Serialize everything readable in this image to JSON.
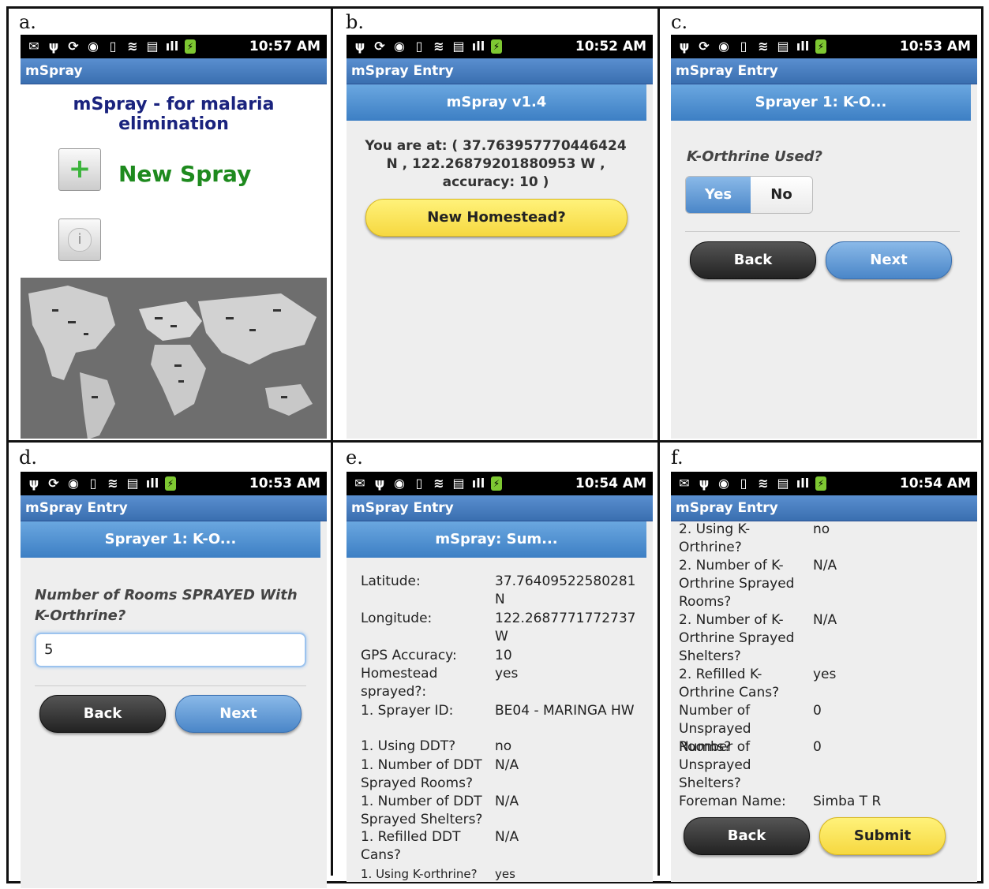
{
  "panels": {
    "a": {
      "label": "a.",
      "time": "10:57 AM",
      "appbar": "mSpray",
      "title": "mSpray - for malaria elimination",
      "new_spray": "New Spray",
      "plus": "+",
      "info": "i"
    },
    "b": {
      "label": "b.",
      "time": "10:52 AM",
      "appbar": "mSpray Entry",
      "header": "mSpray v1.4",
      "location": "You are at: ( 37.763957770446424 N , 122.26879201880953 W , accuracy: 10 )",
      "button": "New Homestead?"
    },
    "c": {
      "label": "c.",
      "time": "10:53 AM",
      "appbar": "mSpray Entry",
      "header": "Sprayer 1: K-O...",
      "question": "K-Orthrine Used?",
      "yes": "Yes",
      "no": "No",
      "back": "Back",
      "next": "Next"
    },
    "d": {
      "label": "d.",
      "time": "10:53 AM",
      "appbar": "mSpray Entry",
      "header": "Sprayer 1: K-O...",
      "question": "Number of Rooms SPRAYED With K-Orthrine?",
      "input_value": "5",
      "back": "Back",
      "next": "Next"
    },
    "e": {
      "label": "e.",
      "time": "10:54 AM",
      "appbar": "mSpray Entry",
      "header": "mSpray: Sum...",
      "rows": [
        {
          "k": "Latitude:",
          "v": "37.76409522580281 N"
        },
        {
          "k": "Longitude:",
          "v": "122.2687771772737 W"
        },
        {
          "k": "GPS Accuracy:",
          "v": "10"
        },
        {
          "k": "Homestead sprayed?:",
          "v": "yes"
        },
        {
          "k": "1. Sprayer ID:",
          "v": "BE04 - MARINGA HW"
        },
        {
          "k": "1. Using DDT?",
          "v": "no"
        },
        {
          "k": "1. Number of DDT Sprayed Rooms?",
          "v": "N/A"
        },
        {
          "k": "1. Number of DDT Sprayed Shelters?",
          "v": "N/A"
        },
        {
          "k": "1. Refilled DDT Cans?",
          "v": "N/A"
        },
        {
          "k": "1. Using K-orthrine?",
          "v": "yes"
        }
      ]
    },
    "f": {
      "label": "f.",
      "time": "10:54 AM",
      "appbar": "mSpray Entry",
      "rows": [
        {
          "k": "2. Using K-Orthrine?",
          "v": "no"
        },
        {
          "k": "2. Number of K-Orthrine Sprayed Rooms?",
          "v": "N/A"
        },
        {
          "k": "2. Number of K-Orthrine Sprayed Shelters?",
          "v": "N/A"
        },
        {
          "k": "2. Refilled K-Orthrine Cans?",
          "v": "yes"
        },
        {
          "k": "Number of Unsprayed Rooms?",
          "v": "0"
        },
        {
          "k": "Number of Unsprayed Shelters?",
          "v": "0"
        },
        {
          "k": "Foreman Name:",
          "v": "Simba T R"
        }
      ],
      "back": "Back",
      "submit": "Submit"
    }
  }
}
